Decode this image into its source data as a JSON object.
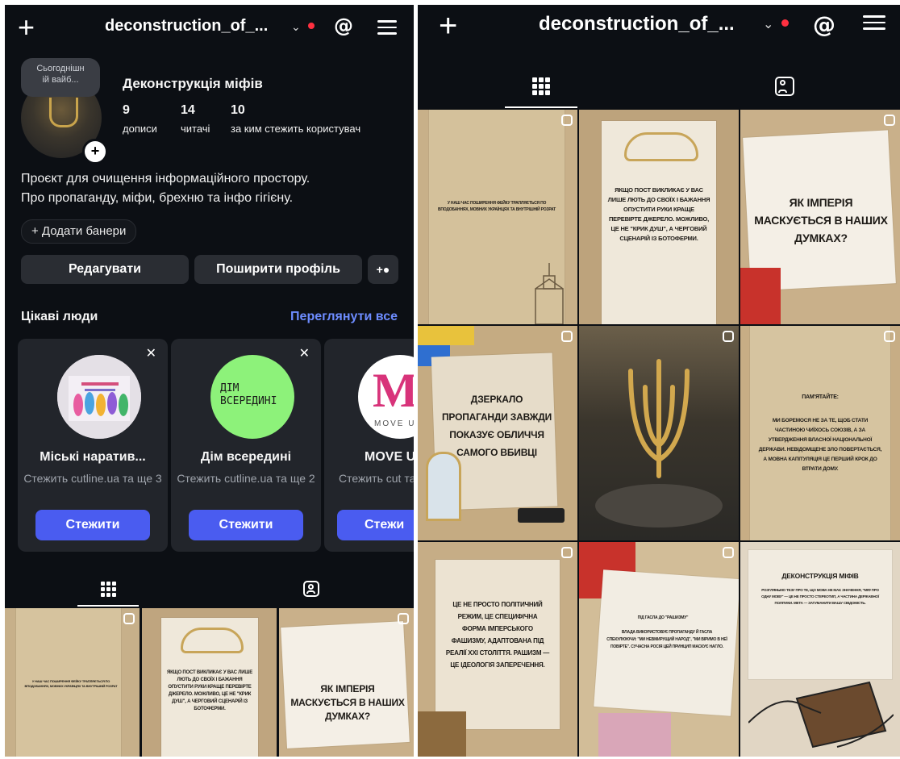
{
  "left": {
    "username": "deconstruction_of_...",
    "story_bubble": "Сьогоднішн\nій вайб...",
    "profile_name": "Деконструкція міфів",
    "stats": [
      {
        "count": "9",
        "label": "дописи"
      },
      {
        "count": "14",
        "label": "читачі"
      },
      {
        "count": "10",
        "label": "за ким стежить користувач"
      }
    ],
    "bio": [
      "Проєкт для очищення інформаційного простору.",
      "Про пропаганду, міфи, брехню та інфо гігієну."
    ],
    "add_banners": "+ Додати банери",
    "edit_button": "Редагувати",
    "share_button": "Поширити профіль",
    "suggestions_title": "Цікаві люди",
    "see_all": "Переглянути все",
    "suggestions": [
      {
        "name": "Міські наратив...",
        "subtitle": "Стежить cutline.ua та ще 3",
        "button": "Стежити"
      },
      {
        "name": "Дім всередині",
        "subtitle": "Стежить cutline.ua та ще 2",
        "button": "Стежити",
        "pic_text": "ДІМ\nВСЕРЕДИНІ"
      },
      {
        "name": "MOVE U",
        "subtitle": "Стежить cut та ще",
        "button": "Стежи",
        "pic_text": "M",
        "pic_sub": "MOVE U"
      }
    ]
  },
  "right": {
    "username": "deconstruction_of_..."
  },
  "posts": [
    {
      "text": "У наш час поширення фейку трапляється по вподобаннях, мовних українцях та внутрішній розрат"
    },
    {
      "text": "Якщо пост викликає у вас лише лють до своїх і бажання опустити руки краще перевірте джерело. Можливо, це не \"крик душ\", а черговий сценарій із ботоферми."
    },
    {
      "text": "Як імперія маскується в наших думках?"
    },
    {
      "text": "Дзеркало пропаганди завжди показує обличчя самого вбивці"
    },
    {
      "text": ""
    },
    {
      "title": "Пам'ятайте:",
      "text": "Ми боремося не за те, щоб стати частиною чиїхось союзів, а за утвердження власної національної держави. Невідомщене зло повертається, а мовна капітуляція це перший крок до втрати дому."
    },
    {
      "text": "Це не просто політичний режим, це специфічна форма імперського фашизму, адаптована під реалії XXI століття. Рашизм — це ідеологія заперечення."
    },
    {
      "title": "Під гасла до \"Рашизму\"",
      "text": "Влада використовує пропаганду й гасла спекулюючи: \"ми невмирущий народ\", \"ми віримо в неї повірте\". Сучасна росія цей принцип маскує нагло."
    },
    {
      "title": "Деконструкція міфів",
      "text": "Розгляньмо тезу про те, що мова не має значення, \"міф про одну мову\" — це не просто стереотип, а частина державної політики. Мета — затуманити вашу свідомість."
    }
  ],
  "colors": {
    "background": "#0c0f14",
    "card": "#22252b",
    "button_dark": "#2a2d33",
    "accent": "#4a5cf0",
    "link": "#6d8cff",
    "dot": "#ff3040"
  }
}
